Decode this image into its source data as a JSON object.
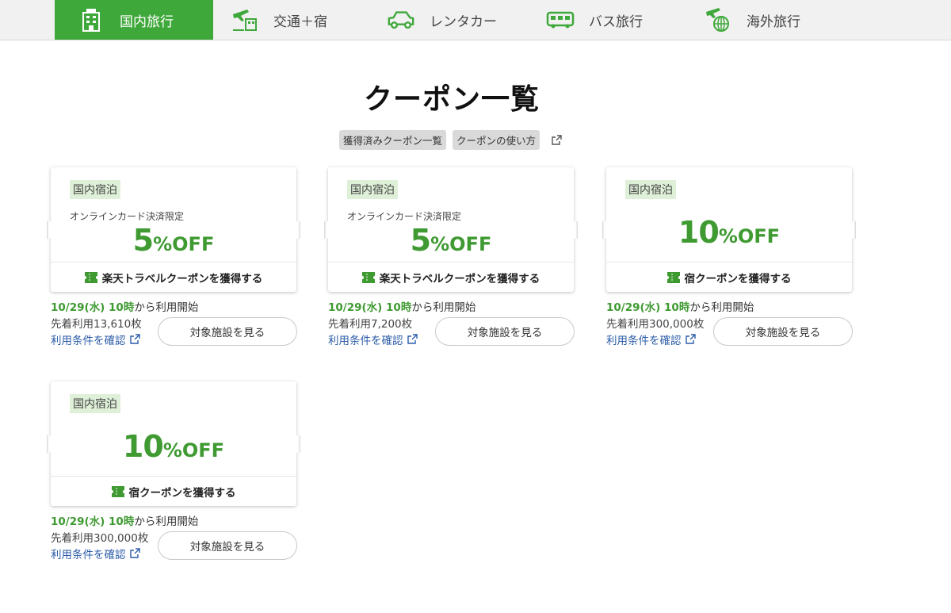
{
  "nav": {
    "tabs": [
      {
        "label": "国内旅行",
        "icon": "hotel-icon",
        "active": true
      },
      {
        "label": "交通＋宿",
        "icon": "plane-hotel-icon",
        "active": false
      },
      {
        "label": "レンタカー",
        "icon": "car-icon",
        "active": false
      },
      {
        "label": "バス旅行",
        "icon": "bus-icon",
        "active": false
      },
      {
        "label": "海外旅行",
        "icon": "globe-plane-icon",
        "active": false
      }
    ]
  },
  "page": {
    "title": "クーポン一覧",
    "links": {
      "acquired": "獲得済みクーポン一覧",
      "howto": "クーポンの使い方"
    }
  },
  "coupons": [
    {
      "tag": "国内宿泊",
      "condition": "オンラインカード決済限定",
      "discount_num": "5",
      "discount_unit": "%OFF",
      "get_label": "楽天トラベルクーポンを獲得する",
      "start_date": "10/29(水) 10時",
      "start_suffix": "から利用開始",
      "remain": "先着利用13,610枚",
      "terms": "利用条件を確認",
      "see": "対象施設を見る"
    },
    {
      "tag": "国内宿泊",
      "condition": "オンラインカード決済限定",
      "discount_num": "5",
      "discount_unit": "%OFF",
      "get_label": "楽天トラベルクーポンを獲得する",
      "start_date": "10/29(水) 10時",
      "start_suffix": "から利用開始",
      "remain": "先着利用7,200枚",
      "terms": "利用条件を確認",
      "see": "対象施設を見る"
    },
    {
      "tag": "国内宿泊",
      "condition": "",
      "discount_num": "10",
      "discount_unit": "%OFF",
      "get_label": "宿クーポンを獲得する",
      "start_date": "10/29(水) 10時",
      "start_suffix": "から利用開始",
      "remain": "先着利用300,000枚",
      "terms": "利用条件を確認",
      "see": "対象施設を見る"
    },
    {
      "tag": "国内宿泊",
      "condition": "",
      "discount_num": "10",
      "discount_unit": "%OFF",
      "get_label": "宿クーポンを獲得する",
      "start_date": "10/29(水) 10時",
      "start_suffix": "から利用開始",
      "remain": "先着利用300,000枚",
      "terms": "利用条件を確認",
      "see": "対象施設を見る"
    }
  ],
  "colors": {
    "brand_green": "#3fa83a",
    "discount_green": "#3f9a32",
    "link_blue": "#2b5ca8",
    "tag_bg": "#dff0d8"
  }
}
